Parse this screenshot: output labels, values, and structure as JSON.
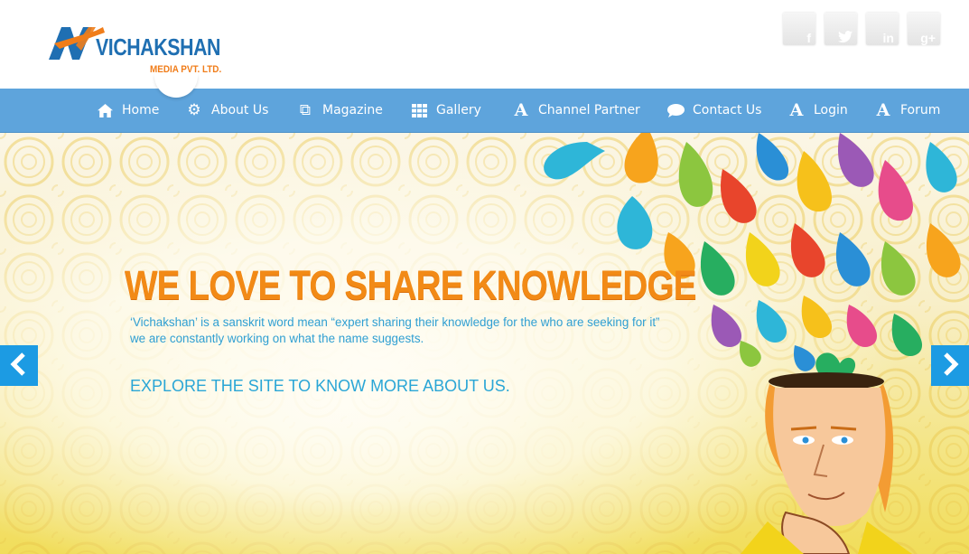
{
  "brand": {
    "name": "VICHAKSHAN",
    "subtitle": "MEDIA PVT. LTD.",
    "primary_color": "#1f6fb2",
    "accent_color": "#f07d1a"
  },
  "social": [
    {
      "name": "facebook",
      "glyph": "f"
    },
    {
      "name": "twitter",
      "glyph": "t"
    },
    {
      "name": "linkedin",
      "glyph": "in"
    },
    {
      "name": "google-plus",
      "glyph": "g+"
    }
  ],
  "nav": {
    "background": "#5ea4dc",
    "items": [
      {
        "label": "Home",
        "icon": "home-icon",
        "glyph": "⌂"
      },
      {
        "label": "About Us",
        "icon": "gears-icon",
        "glyph": "⚙"
      },
      {
        "label": "Magazine",
        "icon": "copy-icon",
        "glyph": "⧉"
      },
      {
        "label": "Gallery",
        "icon": "grid-icon",
        "glyph": "▦"
      },
      {
        "label": "Channel Partner",
        "icon": "font-icon",
        "glyph": "A"
      },
      {
        "label": "Contact Us",
        "icon": "comment-icon",
        "glyph": "💬"
      },
      {
        "label": "Login",
        "icon": "font-icon",
        "glyph": "A"
      },
      {
        "label": "Forum",
        "icon": "font-icon",
        "glyph": "A"
      }
    ]
  },
  "hero": {
    "headline": "WE LOVE TO SHARE KNOWLEDGE",
    "description": "‘Vichakshan’ is a sanskrit word mean “expert sharing their knowledge for the who are seeking for it” we are constantly working on what the name suggests.",
    "cta": "EXPLORE THE SITE TO KNOW MORE ABOUT US.",
    "headline_color": "#f28a16",
    "text_color": "#2f9fd2"
  },
  "slider": {
    "prev_icon": "chevron-left-icon",
    "next_icon": "chevron-right-icon",
    "arrow_color": "#1c9be3"
  }
}
